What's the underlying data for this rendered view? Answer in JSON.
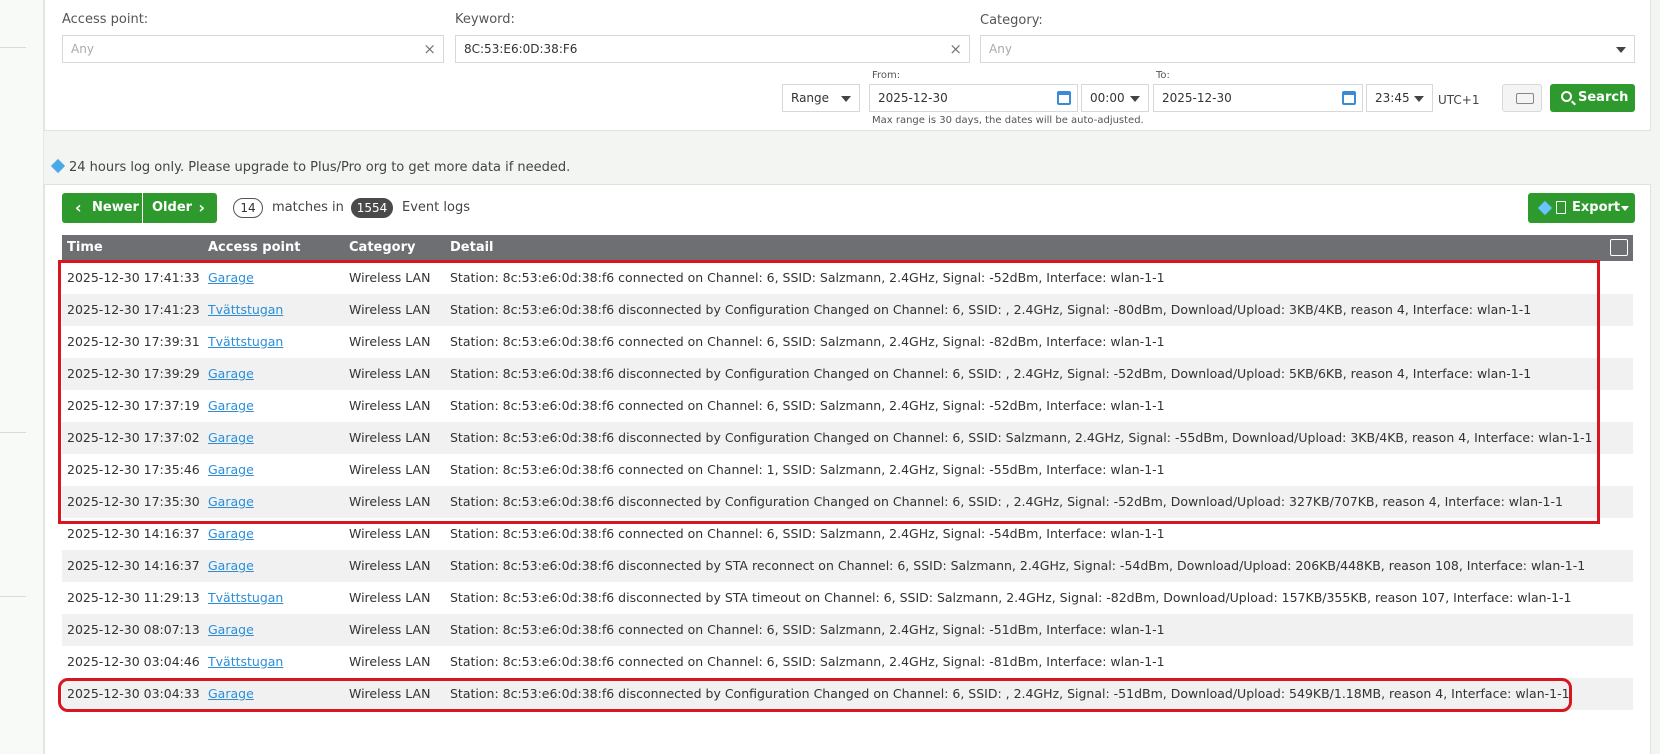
{
  "filters": {
    "access_point": {
      "label": "Access point:",
      "placeholder": "Any"
    },
    "keyword": {
      "label": "Keyword:",
      "value": "8C:53:E6:0D:38:F6"
    },
    "category": {
      "label": "Category:",
      "placeholder": "Any"
    },
    "range_mode": "Range",
    "from": {
      "label": "From:",
      "date": "2025-12-30",
      "time": "00:00"
    },
    "to": {
      "label": "To:",
      "date": "2025-12-30",
      "time": "23:45"
    },
    "timezone": "UTC+1",
    "range_hint": "Max range is 30 days, the dates will be auto-adjusted.",
    "search_label": "Search"
  },
  "notice": "24 hours log only. Please upgrade to Plus/Pro org to get more data if needed.",
  "toolbar": {
    "newer": "Newer",
    "older": "Older",
    "match_count": "14",
    "matches_in": "matches in",
    "total": "1554",
    "event_logs": "Event logs",
    "export": "Export"
  },
  "table": {
    "columns": [
      "Time",
      "Access point",
      "Category",
      "Detail"
    ],
    "rows": [
      [
        "2025-12-30 17:41:33",
        "Garage",
        "Wireless LAN",
        "Station: 8c:53:e6:0d:38:f6 connected on Channel: 6, SSID: Salzmann, 2.4GHz, Signal: -52dBm, Interface: wlan-1-1"
      ],
      [
        "2025-12-30 17:41:23",
        "Tvättstugan",
        "Wireless LAN",
        "Station: 8c:53:e6:0d:38:f6 disconnected by Configuration Changed on Channel: 6, SSID: , 2.4GHz, Signal: -80dBm, Download/Upload: 3KB/4KB, reason 4, Interface: wlan-1-1"
      ],
      [
        "2025-12-30 17:39:31",
        "Tvättstugan",
        "Wireless LAN",
        "Station: 8c:53:e6:0d:38:f6 connected on Channel: 6, SSID: Salzmann, 2.4GHz, Signal: -82dBm, Interface: wlan-1-1"
      ],
      [
        "2025-12-30 17:39:29",
        "Garage",
        "Wireless LAN",
        "Station: 8c:53:e6:0d:38:f6 disconnected by Configuration Changed on Channel: 6, SSID: , 2.4GHz, Signal: -52dBm, Download/Upload: 5KB/6KB, reason 4, Interface: wlan-1-1"
      ],
      [
        "2025-12-30 17:37:19",
        "Garage",
        "Wireless LAN",
        "Station: 8c:53:e6:0d:38:f6 connected on Channel: 6, SSID: Salzmann, 2.4GHz, Signal: -52dBm, Interface: wlan-1-1"
      ],
      [
        "2025-12-30 17:37:02",
        "Garage",
        "Wireless LAN",
        "Station: 8c:53:e6:0d:38:f6 disconnected by Configuration Changed on Channel: 6, SSID: Salzmann, 2.4GHz, Signal: -55dBm, Download/Upload: 3KB/4KB, reason 4, Interface: wlan-1-1"
      ],
      [
        "2025-12-30 17:35:46",
        "Garage",
        "Wireless LAN",
        "Station: 8c:53:e6:0d:38:f6 connected on Channel: 1, SSID: Salzmann, 2.4GHz, Signal: -55dBm, Interface: wlan-1-1"
      ],
      [
        "2025-12-30 17:35:30",
        "Garage",
        "Wireless LAN",
        "Station: 8c:53:e6:0d:38:f6 disconnected by Configuration Changed on Channel: 6, SSID: , 2.4GHz, Signal: -52dBm, Download/Upload: 327KB/707KB, reason 4, Interface: wlan-1-1"
      ],
      [
        "2025-12-30 14:16:37",
        "Garage",
        "Wireless LAN",
        "Station: 8c:53:e6:0d:38:f6 connected on Channel: 6, SSID: Salzmann, 2.4GHz, Signal: -54dBm, Interface: wlan-1-1"
      ],
      [
        "2025-12-30 14:16:37",
        "Garage",
        "Wireless LAN",
        "Station: 8c:53:e6:0d:38:f6 disconnected by STA reconnect on Channel: 6, SSID: Salzmann, 2.4GHz, Signal: -54dBm, Download/Upload: 206KB/448KB, reason 108, Interface: wlan-1-1"
      ],
      [
        "2025-12-30 11:29:13",
        "Tvättstugan",
        "Wireless LAN",
        "Station: 8c:53:e6:0d:38:f6 disconnected by STA timeout on Channel: 6, SSID: Salzmann, 2.4GHz, Signal: -82dBm, Download/Upload: 157KB/355KB, reason 107, Interface: wlan-1-1"
      ],
      [
        "2025-12-30 08:07:13",
        "Garage",
        "Wireless LAN",
        "Station: 8c:53:e6:0d:38:f6 connected on Channel: 6, SSID: Salzmann, 2.4GHz, Signal: -51dBm, Interface: wlan-1-1"
      ],
      [
        "2025-12-30 03:04:46",
        "Tvättstugan",
        "Wireless LAN",
        "Station: 8c:53:e6:0d:38:f6 connected on Channel: 6, SSID: Salzmann, 2.4GHz, Signal: -81dBm, Interface: wlan-1-1"
      ],
      [
        "2025-12-30 03:04:33",
        "Garage",
        "Wireless LAN",
        "Station: 8c:53:e6:0d:38:f6 disconnected by Configuration Changed on Channel: 6, SSID: , 2.4GHz, Signal: -51dBm, Download/Upload: 549KB/1.18MB, reason 4, Interface: wlan-1-1"
      ]
    ]
  },
  "colors": {
    "brand_green": "#2e9a2e",
    "link_blue": "#2a8fd8",
    "highlight_red": "#d8161f",
    "header_gray": "#6d6f72"
  }
}
